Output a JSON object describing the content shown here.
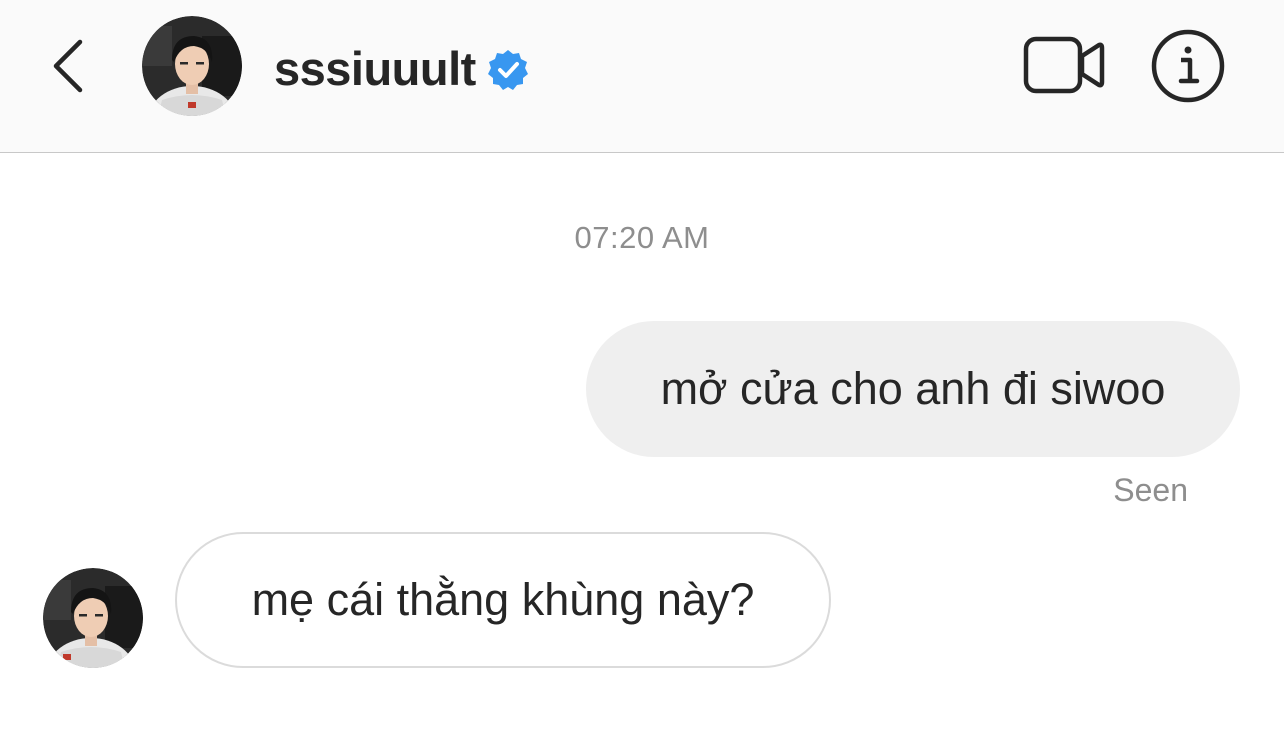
{
  "header": {
    "username": "sssiuuult",
    "verified": true,
    "icons": {
      "back": "chevron-left-icon",
      "verified": "verified-badge-icon",
      "video_call": "video-camera-icon",
      "info": "info-icon"
    }
  },
  "conversation": {
    "timestamp": "07:20 AM",
    "messages": [
      {
        "direction": "outgoing",
        "text": "mở cửa cho anh đi siwoo",
        "status": "Seen"
      },
      {
        "direction": "incoming",
        "text": "mẹ cái thằng khùng này?"
      }
    ]
  },
  "colors": {
    "header_bg": "#fafafa",
    "verified_blue": "#3897f0",
    "outgoing_bubble": "#efefef",
    "incoming_border": "#dbdbdb",
    "meta_text": "#8e8e8e",
    "text": "#262626"
  }
}
